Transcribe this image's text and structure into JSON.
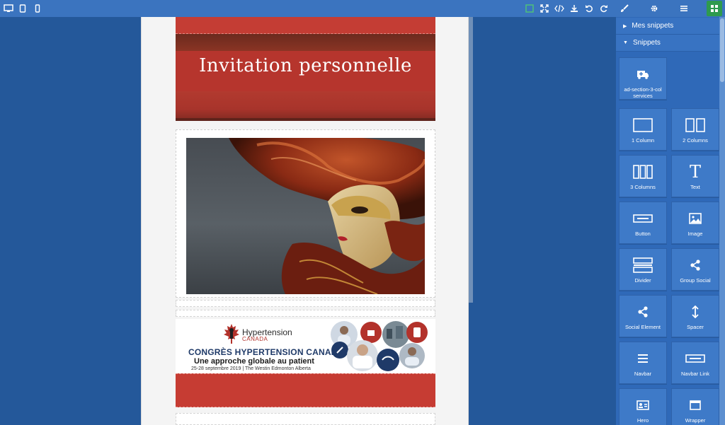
{
  "email": {
    "header_title": "Invitation personnelle",
    "banner": {
      "logo_name": "Hypertension",
      "logo_sub": "CANADA",
      "headline": "CONGRÈS HYPERTENSION CANADA",
      "subline": "Une approche globale au patient",
      "dates": "25-28 septembre 2019  |  The Westin Edmonton Alberta"
    }
  },
  "panel": {
    "sections": [
      {
        "label": "Mes snippets",
        "state": "collapsed"
      },
      {
        "label": "Snippets",
        "state": "expanded"
      }
    ],
    "snippets": [
      {
        "label": "ad-section-3-col services",
        "icon": "ambulance-icon"
      },
      {
        "label": "1 Column",
        "icon": "one-column-icon"
      },
      {
        "label": "2 Columns",
        "icon": "two-columns-icon"
      },
      {
        "label": "3 Columns",
        "icon": "three-columns-icon"
      },
      {
        "label": "Text",
        "icon": "text-icon"
      },
      {
        "label": "Button",
        "icon": "button-icon"
      },
      {
        "label": "Image",
        "icon": "image-icon"
      },
      {
        "label": "Divider",
        "icon": "divider-icon"
      },
      {
        "label": "Group Social",
        "icon": "share-icon"
      },
      {
        "label": "Social Element",
        "icon": "share-icon"
      },
      {
        "label": "Spacer",
        "icon": "vertical-arrows-icon"
      },
      {
        "label": "Navbar",
        "icon": "hamburger-icon"
      },
      {
        "label": "Navbar Link",
        "icon": "link-box-icon"
      },
      {
        "label": "Hero",
        "icon": "id-card-icon"
      },
      {
        "label": "Wrapper",
        "icon": "window-icon"
      }
    ]
  },
  "colors": {
    "toolbar": "#3b74bf",
    "background": "#24589a",
    "panel": "#2f69b8",
    "accent_red": "#c63c33",
    "active_green": "#2e9a4f"
  }
}
